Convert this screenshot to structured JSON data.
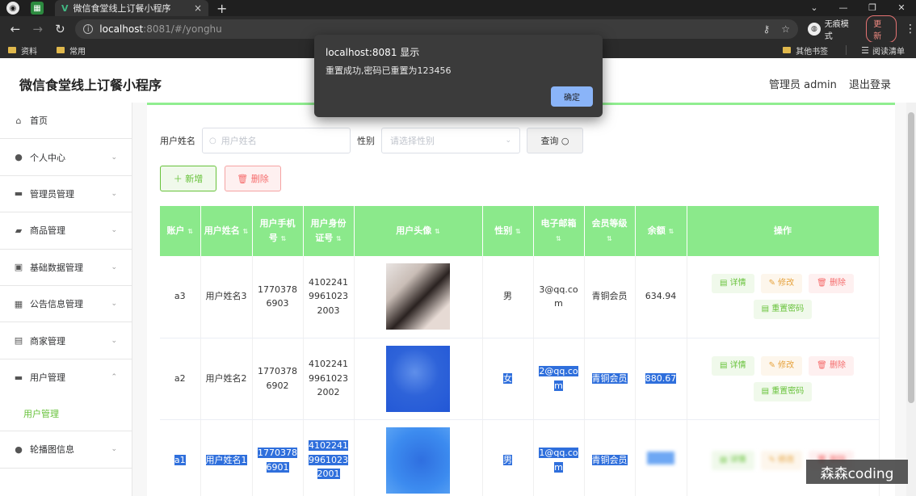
{
  "browser": {
    "tab_title": "微信食堂线上订餐小程序",
    "tab_close": "×",
    "new_tab": "+",
    "window_controls": [
      "⌄",
      "—",
      "❐",
      "✕"
    ],
    "url_host": "localhost",
    "url_path": ":8081/#/yonghu",
    "incognito_label": "无痕模式",
    "update_label": "更新",
    "bookmarks": [
      "资料",
      "常用"
    ],
    "bookmarks_right": [
      "其他书签",
      "阅读清单"
    ]
  },
  "header": {
    "site_title": "微信食堂线上订餐小程序",
    "admin_label": "管理员 admin",
    "logout_label": "退出登录"
  },
  "sidebar": {
    "items": [
      {
        "label": "首页",
        "icon": "home-icon",
        "glyph": "⌂",
        "arrow": ""
      },
      {
        "label": "个人中心",
        "icon": "user-icon",
        "glyph": "●",
        "arrow": "⌄"
      },
      {
        "label": "管理员管理",
        "icon": "admin-icon",
        "glyph": "▬",
        "arrow": "⌄"
      },
      {
        "label": "商品管理",
        "icon": "goods-icon",
        "glyph": "▰",
        "arrow": "⌄"
      },
      {
        "label": "基础数据管理",
        "icon": "clipboard-icon",
        "glyph": "▣",
        "arrow": "⌄"
      },
      {
        "label": "公告信息管理",
        "icon": "grid-icon",
        "glyph": "▦",
        "arrow": "⌄"
      },
      {
        "label": "商家管理",
        "icon": "document-icon",
        "glyph": "▤",
        "arrow": "⌄"
      },
      {
        "label": "用户管理",
        "icon": "chat-icon",
        "glyph": "▬",
        "arrow": "⌃"
      }
    ],
    "sub_item": "用户管理",
    "last_item": {
      "label": "轮播图信息",
      "icon": "user-icon",
      "glyph": "●",
      "arrow": "⌄"
    }
  },
  "search": {
    "name_label": "用户姓名",
    "name_placeholder": "用户姓名",
    "gender_label": "性别",
    "gender_placeholder": "请选择性别",
    "query_label": "查询 ○"
  },
  "actions": {
    "add_label": "＋ 新增",
    "delete_label": "🗑 删除"
  },
  "table": {
    "columns": [
      "账户",
      "用户姓名",
      "用户手机号",
      "用户身份证号",
      "用户头像",
      "性别",
      "电子邮箱",
      "会员等级",
      "余额",
      "操作"
    ],
    "sort_glyph": "⇅",
    "rows": [
      {
        "account": "a3",
        "name": "用户姓名3",
        "phone": "17703786903",
        "id_card": "410224199610232003",
        "gender": "男",
        "email": "3@qq.com",
        "level": "青铜会员",
        "balance": "634.94"
      },
      {
        "account": "a2",
        "name": "用户姓名2",
        "phone": "17703786902",
        "id_card": "410224199610232002",
        "gender": "女",
        "email": "2@qq.com",
        "level": "青铜会员",
        "balance": "880.67"
      },
      {
        "account": "a1",
        "name": "用户姓名1",
        "phone": "17703786901",
        "id_card": "410224199610232001",
        "gender": "男",
        "email": "1@qq.com",
        "level": "青铜会员",
        "balance": ""
      }
    ],
    "ops": {
      "detail": "▤ 详情",
      "edit": "✎ 修改",
      "delete": "🗑 删除",
      "reset": "▤ 重置密码"
    }
  },
  "dialog": {
    "title": "localhost:8081 显示",
    "message": "重置成功,密码已重置为123456",
    "ok_label": "确定"
  },
  "watermark": "森森coding",
  "colors": {
    "accent": "#67c23a",
    "table_header": "#8be98b",
    "selection": "#2f6fdc"
  }
}
